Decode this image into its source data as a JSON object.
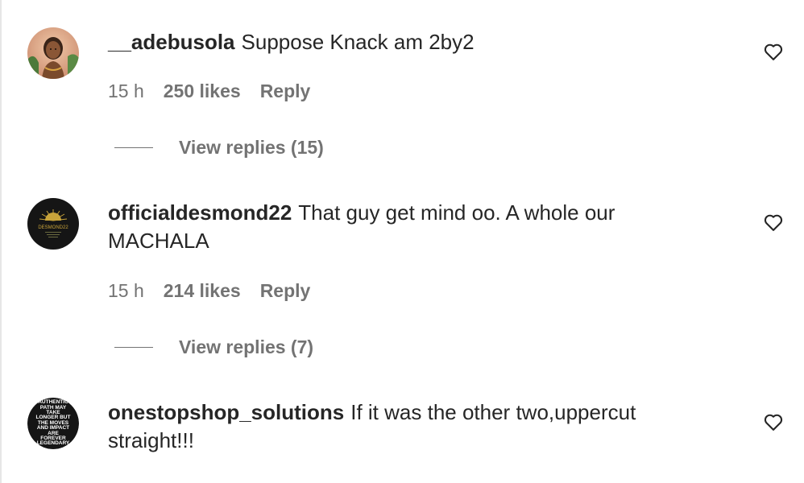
{
  "comments": [
    {
      "username": "__adebusola",
      "text": "Suppose Knack am 2by2",
      "time": "15 h",
      "likes": "250 likes",
      "reply_label": "Reply",
      "view_replies": "View replies (15)",
      "avatar_icon": "profile-photo-woman"
    },
    {
      "username": "officialdesmond22",
      "text": "That guy get mind oo. A whole our MACHALA",
      "time": "15 h",
      "likes": "214 likes",
      "reply_label": "Reply",
      "view_replies": "View replies (7)",
      "avatar_icon": "desmond22-logo",
      "avatar_text": "DESMOND22"
    },
    {
      "username": "onestopshop_solutions",
      "text": "If it was the other two,uppercut straight!!!",
      "avatar_icon": "quote-text-logo",
      "avatar_text": "AUTHENTIC PATH MAY TAKE LONGER BUT THE MOVES AND IMPACT ARE FOREVER LEGENDARY"
    }
  ],
  "colors": {
    "text": "#262626",
    "secondary": "#737373",
    "background": "#ffffff"
  }
}
